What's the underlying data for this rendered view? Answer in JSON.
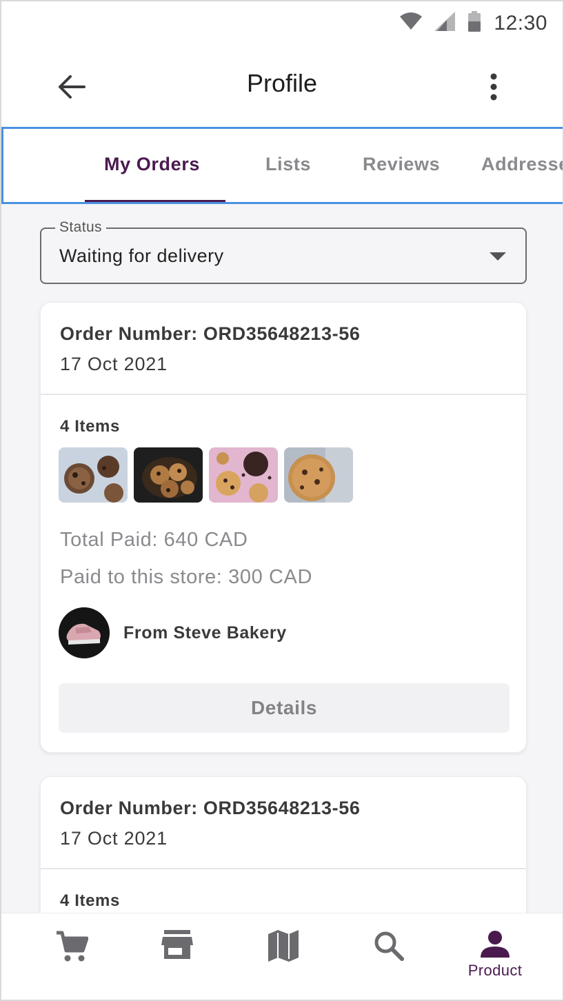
{
  "status_bar": {
    "time": "12:30"
  },
  "app_bar": {
    "title": "Profile"
  },
  "tabs": [
    {
      "label": "My Orders",
      "active": true
    },
    {
      "label": "Lists",
      "active": false
    },
    {
      "label": "Reviews",
      "active": false
    },
    {
      "label": "Addresses",
      "active": false
    }
  ],
  "filter": {
    "label": "Status",
    "value": "Waiting for delivery"
  },
  "orders": [
    {
      "order_number": "Order Number: ORD35648213-56",
      "date": "17 Oct 2021",
      "items_count": "4 Items",
      "total_paid": "Total Paid: 640 CAD",
      "paid_to_store": "Paid to this store: 300 CAD",
      "store": "From Steve Bakery",
      "details_label": "Details"
    },
    {
      "order_number": "Order Number: ORD35648213-56",
      "date": "17 Oct 2021",
      "items_count": "4 Items"
    }
  ],
  "bottom_nav": [
    {
      "icon": "cart-icon",
      "label": ""
    },
    {
      "icon": "store-icon",
      "label": ""
    },
    {
      "icon": "map-icon",
      "label": ""
    },
    {
      "icon": "search-icon",
      "label": ""
    },
    {
      "icon": "person-icon",
      "label": "Product",
      "active": true
    }
  ],
  "colors": {
    "accent": "#4a1a4f",
    "tab_border": "#4a90e2",
    "muted_text": "#8a8a8e"
  }
}
